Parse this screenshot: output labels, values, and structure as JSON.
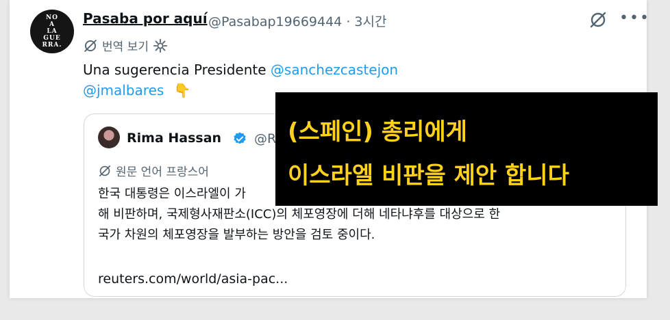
{
  "post": {
    "author_name": "Pasaba por aquí",
    "author_handle": "@Pasabap19669444",
    "time_sep": "·",
    "time": "3시간",
    "translate_label": "번역 보기",
    "text_prefix": "Una sugerencia Presidente",
    "mention_1": "@sanchezcastejon",
    "mention_2": "@jmalbares",
    "emoji": "👇",
    "avatar_logo": "NO\nA\nLA\nGUE\nRRA."
  },
  "quote": {
    "author_name": "Rima Hassan",
    "author_handle": "@Ri",
    "lang_note": "원문 언어 프랑스어",
    "text_lines": [
      "한국 대통령은 이스라엘이 가",
      "해 비판하며, 국제형사재판소(ICC)의 체포영장에 더해 네타냐후를 대상으로 한",
      "국가 차원의 체포영장을 발부하는 방안을 검토 중이다."
    ],
    "link": "reuters.com/world/asia-pac..."
  },
  "overlay": {
    "line_1": "(스페인) 총리에게",
    "line_2": "이스라엘 비판을 제안 합니다"
  },
  "icons": {
    "more": "more-icon",
    "grok": "grok-icon",
    "gear": "gear-icon",
    "verified": "verified-badge-icon"
  },
  "colors": {
    "mention": "#1d9bf0",
    "secondary_text": "#536471",
    "overlay_text": "#ffd21a",
    "overlay_bg": "#000000"
  }
}
